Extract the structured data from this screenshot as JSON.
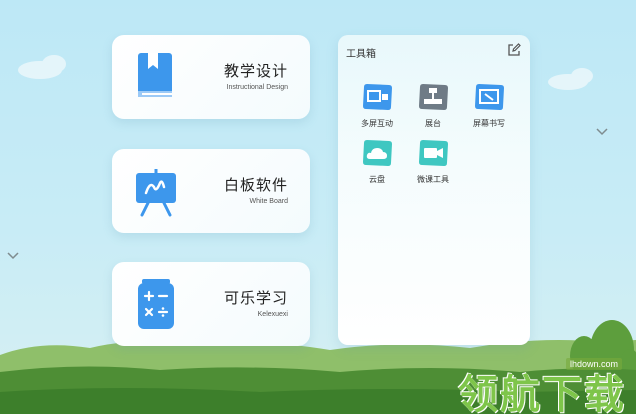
{
  "cards": [
    {
      "title": "教学设计",
      "subtitle": "Instructional Design",
      "icon": "book-icon"
    },
    {
      "title": "白板软件",
      "subtitle": "White Board",
      "icon": "whiteboard-easel-icon"
    },
    {
      "title": "可乐学习",
      "subtitle": "Kelexuexi",
      "icon": "calculator-can-icon"
    }
  ],
  "toolbox": {
    "title": "工具箱",
    "edit_icon": "edit-icon",
    "tools": [
      {
        "label": "多屏互动",
        "icon": "multi-screen-icon"
      },
      {
        "label": "展台",
        "icon": "document-camera-icon"
      },
      {
        "label": "屏幕书写",
        "icon": "screen-write-icon"
      },
      {
        "label": "云盘",
        "icon": "cloud-icon"
      },
      {
        "label": "微课工具",
        "icon": "video-camera-icon"
      }
    ]
  },
  "watermark": {
    "url": "lhdown.com",
    "text": "领航下载"
  },
  "colors": {
    "accent": "#3d97ec",
    "tool_teal": "#3fc7c1",
    "tool_gray": "#6f7b86",
    "grass": "#5c9a3c"
  }
}
